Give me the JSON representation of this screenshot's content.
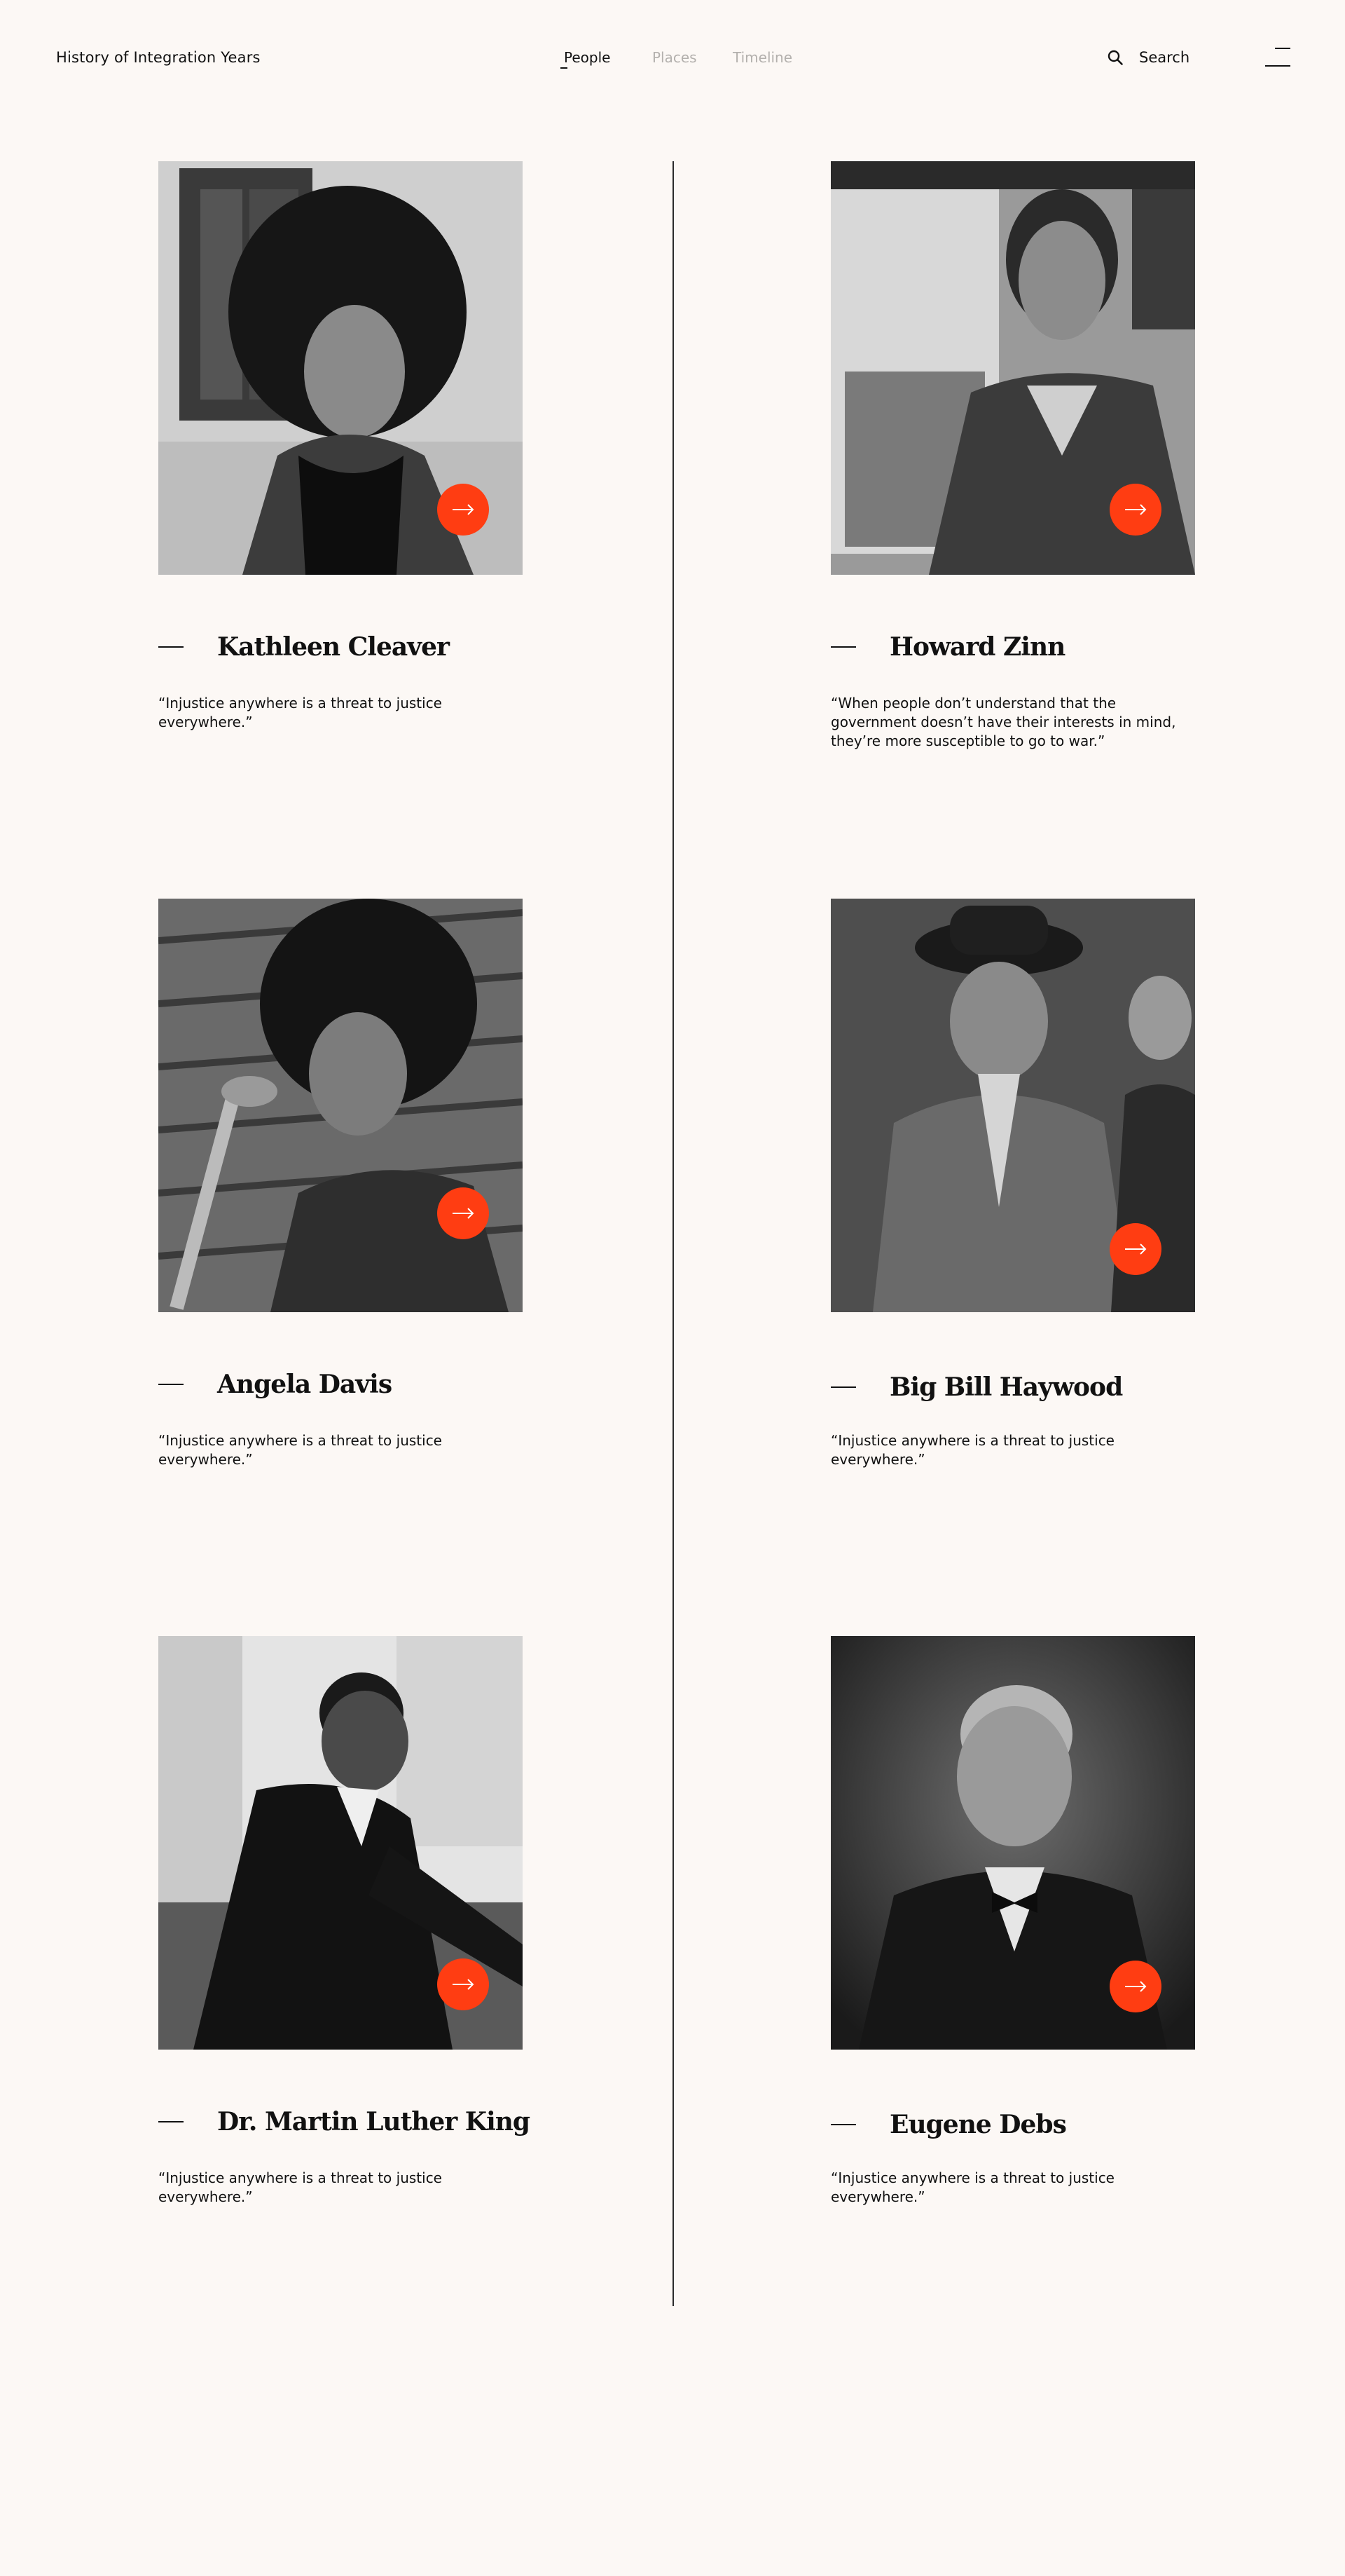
{
  "header": {
    "brand": "History of Integration Years",
    "nav": [
      {
        "label": "People",
        "active": true
      },
      {
        "label": "Places",
        "active": false
      },
      {
        "label": "Timeline",
        "active": false
      }
    ],
    "search_label": "Search",
    "icons": {
      "search": "search-icon",
      "menu": "menu-icon"
    }
  },
  "colors": {
    "background": "#fcf8f5",
    "accent": "#ff3d12",
    "text": "#111111",
    "muted": "#b3b0ad"
  },
  "people": [
    {
      "name": "Kathleen Cleaver",
      "quote": "“Injustice anywhere is a threat to justice everywhere.”"
    },
    {
      "name": "Howard Zinn",
      "quote": "“When people don’t understand that the government doesn’t have their interests in mind, they’re more susceptible to go to war.”"
    },
    {
      "name": "Angela Davis",
      "quote": "“Injustice anywhere is a threat to justice everywhere.”"
    },
    {
      "name": "Big Bill Haywood",
      "quote": "“Injustice anywhere is a threat to justice everywhere.”"
    },
    {
      "name": "Dr. Martin Luther King",
      "quote": "“Injustice anywhere is a threat to justice everywhere.”"
    },
    {
      "name": "Eugene Debs",
      "quote": "“Injustice anywhere is a threat to justice everywhere.”"
    }
  ]
}
